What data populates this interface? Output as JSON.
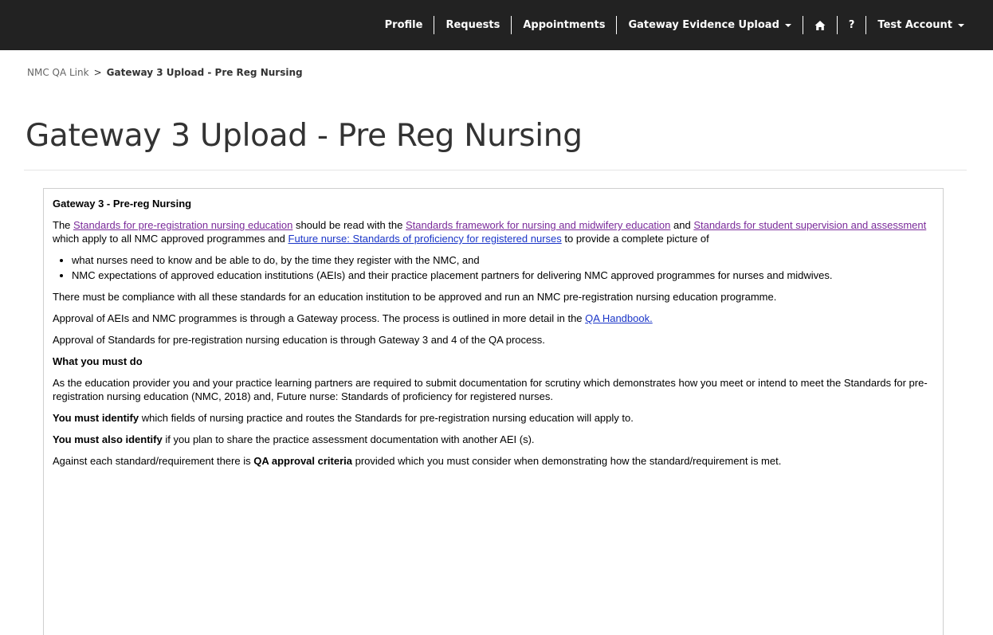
{
  "nav": {
    "items": [
      "Profile",
      "Requests",
      "Appointments",
      "Gateway Evidence Upload"
    ],
    "help_label": "?",
    "account_label": "Test Account",
    "home_icon": "home-icon"
  },
  "breadcrumb": {
    "root": "NMC QA Link",
    "separator": ">",
    "current": "Gateway 3 Upload - Pre Reg Nursing"
  },
  "page": {
    "title": "Gateway 3 Upload - Pre Reg Nursing"
  },
  "content": {
    "heading": "Gateway 3 - Pre-reg Nursing",
    "intro": {
      "t1": "The ",
      "link1": "Standards for pre-registration nursing education",
      "t2": " should be read with the ",
      "link2": "Standards framework for nursing and midwifery education",
      "t3": " and ",
      "link3": "Standards for student supervision and assessment",
      "t4": " which apply to all NMC approved programmes and ",
      "link4": "Future nurse: Standards of proficiency for registered nurses",
      "t5": " to provide a complete picture of"
    },
    "bullets": [
      "what nurses need to know and be able to do, by the time they register with the NMC, and",
      "NMC expectations of approved education institutions (AEIs) and their practice placement partners for delivering NMC approved programmes for nurses and midwives."
    ],
    "compliance": "There must be compliance with all these standards for an education institution to be approved and run an NMC pre-registration nursing education programme.",
    "approval_process": {
      "text": "Approval of AEIs and NMC programmes is through a Gateway process. The process is outlined in more detail in the ",
      "link": "QA Handbook."
    },
    "approval_standards": "Approval of Standards for pre-registration nursing education is through Gateway 3 and 4 of the QA process.",
    "must_do_heading": "What you must do",
    "must_do_text": "As the education provider you and your practice learning partners are required to submit documentation for scrutiny which demonstrates how you meet or intend to meet the Standards for pre-registration nursing education (NMC, 2018) and, Future nurse: Standards of proficiency for registered nurses.",
    "identify": {
      "bold": "You must identify",
      "rest": " which fields of nursing practice and routes the Standards for pre-registration nursing education will apply to."
    },
    "also_identify": {
      "bold": "You must also identify",
      "rest": " if you plan to share the practice assessment documentation with another AEI (s)."
    },
    "criteria": {
      "t1": "Against each standard/requirement there is ",
      "bold": "QA approval criteria",
      "t2": " provided which you must consider when demonstrating how the standard/requirement is met."
    }
  }
}
